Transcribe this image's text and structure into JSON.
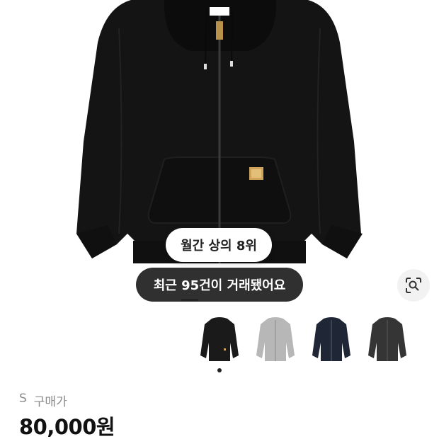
{
  "product": {
    "image_icon": "hooded-zip-sweatshirt-image",
    "rank_badge": "월간 상의 8위",
    "trade_badge": "최근 95건이 거래됐어요",
    "lens_icon": "image-search-icon",
    "colors": [
      {
        "icon": "black-hoodie-thumbnail",
        "color": "#1a1a1a",
        "selected": true
      },
      {
        "icon": "grey-hoodie-thumbnail",
        "color": "#b7b7b7",
        "selected": false
      },
      {
        "icon": "navy-hoodie-thumbnail",
        "color": "#1f2737",
        "selected": false
      },
      {
        "icon": "charcoal-hoodie-thumbnail",
        "color": "#353535",
        "selected": false
      }
    ]
  },
  "purchase": {
    "size": "S",
    "label": "구매가",
    "price": "80,000원"
  }
}
